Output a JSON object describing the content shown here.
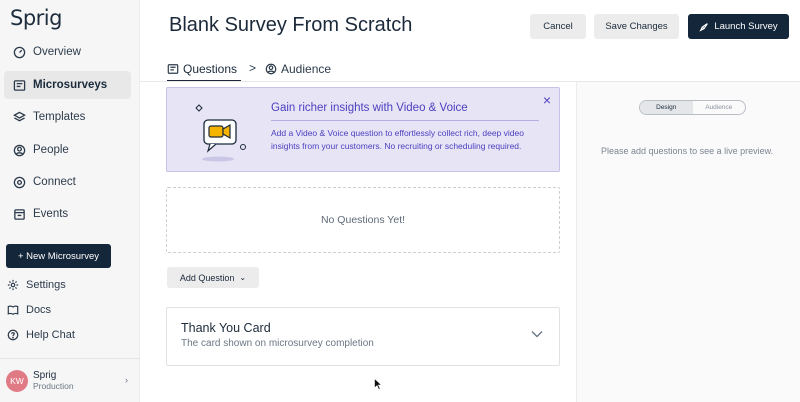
{
  "app": {
    "logo_text": "Sprig"
  },
  "sidebar": {
    "items": [
      {
        "label": "Overview",
        "icon": "dashboard-gauge-icon"
      },
      {
        "label": "Microsurveys",
        "icon": "microsurvey-icon",
        "active": true
      },
      {
        "label": "Templates",
        "icon": "layers-icon"
      },
      {
        "label": "People",
        "icon": "person-icon"
      },
      {
        "label": "Connect",
        "icon": "connect-icon"
      },
      {
        "label": "Events",
        "icon": "events-icon"
      }
    ],
    "new_button": "+ New Microsurvey",
    "links": [
      {
        "label": "Settings",
        "icon": "gear-icon"
      },
      {
        "label": "Docs",
        "icon": "book-icon"
      },
      {
        "label": "Help Chat",
        "icon": "chat-icon"
      }
    ],
    "user": {
      "initials": "KW",
      "name": "Sprig",
      "environment": "Production"
    }
  },
  "header": {
    "title": "Blank Survey From Scratch",
    "cancel_label": "Cancel",
    "save_label": "Save Changes",
    "launch_label": "Launch Survey"
  },
  "tabs": {
    "questions": "Questions",
    "separator": ">",
    "audience": "Audience"
  },
  "banner": {
    "title": "Gain richer insights with Video & Voice",
    "text": "Add a Video & Voice question to effortlessly collect rich, deep video insights from your customers. No recruiting or scheduling required.",
    "close": "×"
  },
  "questions": {
    "empty_text": "No Questions Yet!",
    "add_label": "Add Question"
  },
  "thank_you": {
    "title": "Thank You Card",
    "subtitle": "The card shown on microsurvey completion"
  },
  "preview": {
    "toggle": [
      "Design",
      "Audience"
    ],
    "note": "Please add questions to see a live preview."
  },
  "colors": {
    "primary_dark": "#14263a",
    "accent_purple": "#4d3fc0",
    "banner_bg": "#e6e4f5",
    "avatar_bg": "#e07b86"
  }
}
